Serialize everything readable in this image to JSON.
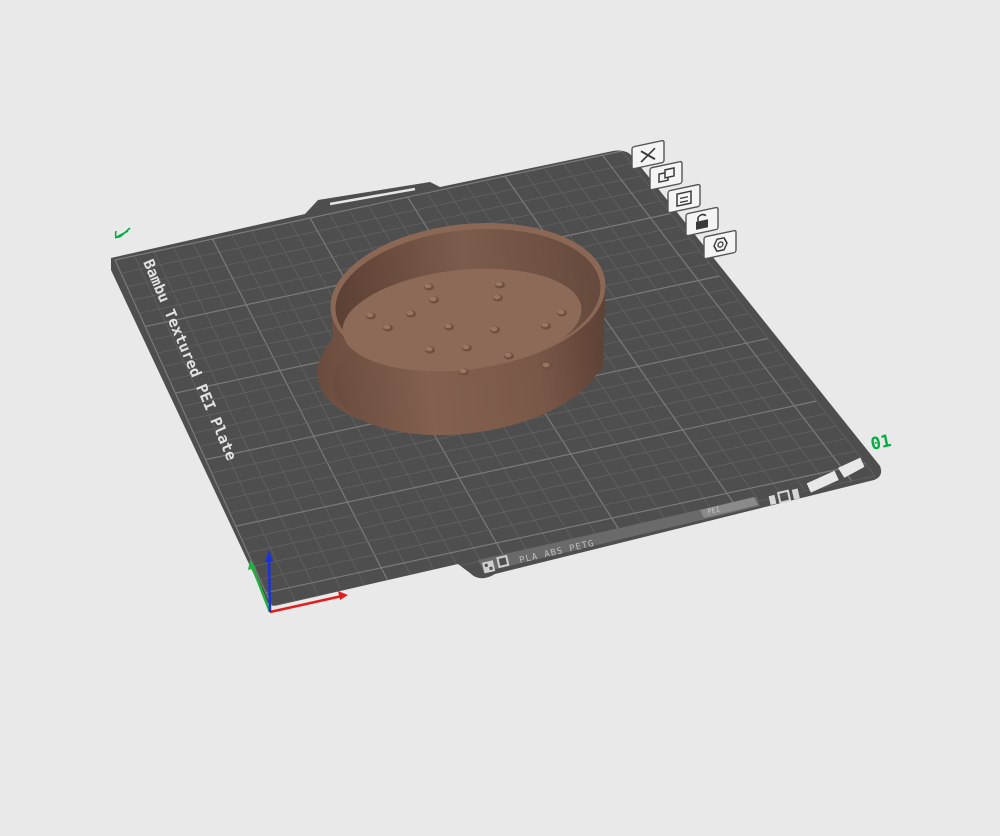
{
  "viewport": {
    "plate_name": "Bambu Textured PEI Plate",
    "plate_number": "01",
    "filament_label": "PLA ABS PETG",
    "corner_marker": "0",
    "slot_label": "PEI"
  },
  "plate_tools": [
    {
      "name": "remove-plate",
      "icon": "close-icon"
    },
    {
      "name": "arrange-plate",
      "icon": "arrange-icon"
    },
    {
      "name": "orient-plate",
      "icon": "orient-icon"
    },
    {
      "name": "lock-plate",
      "icon": "lock-icon"
    },
    {
      "name": "plate-settings",
      "icon": "hexagon-settings-icon"
    }
  ],
  "colors": {
    "background": "#e9e9e9",
    "plate": "#4e4e4e",
    "grid": "#6d6d6d",
    "model": "#7a5a4a",
    "accent_green": "#00ae42",
    "axis_x": "#e02020",
    "axis_y": "#22b040",
    "axis_z": "#1a33d8"
  }
}
